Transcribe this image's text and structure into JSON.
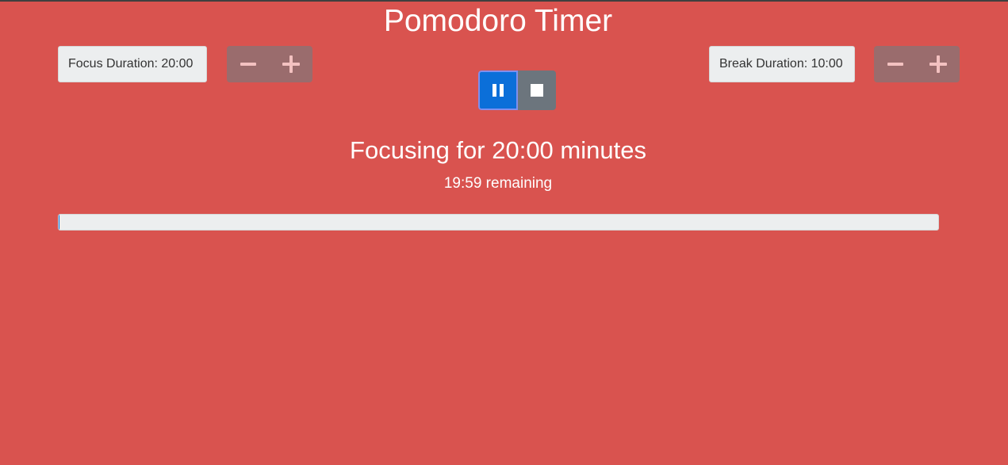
{
  "app": {
    "title": "Pomodoro Timer"
  },
  "focus": {
    "label": "Focus Duration: 20:00",
    "decrease_icon": "minus-icon",
    "increase_icon": "plus-icon"
  },
  "break": {
    "label": "Break Duration: 10:00",
    "decrease_icon": "minus-icon",
    "increase_icon": "plus-icon"
  },
  "controls": {
    "pause_icon": "pause-icon",
    "stop_icon": "stop-icon"
  },
  "status": {
    "heading": "Focusing for 20:00 minutes",
    "remaining": "19:59 remaining"
  },
  "progress": {
    "fraction": 0.001
  },
  "colors": {
    "background": "#d9534f",
    "primary": "#0b6fd9",
    "secondary": "#6c757d",
    "adjust_button": "#9a6c6d"
  }
}
